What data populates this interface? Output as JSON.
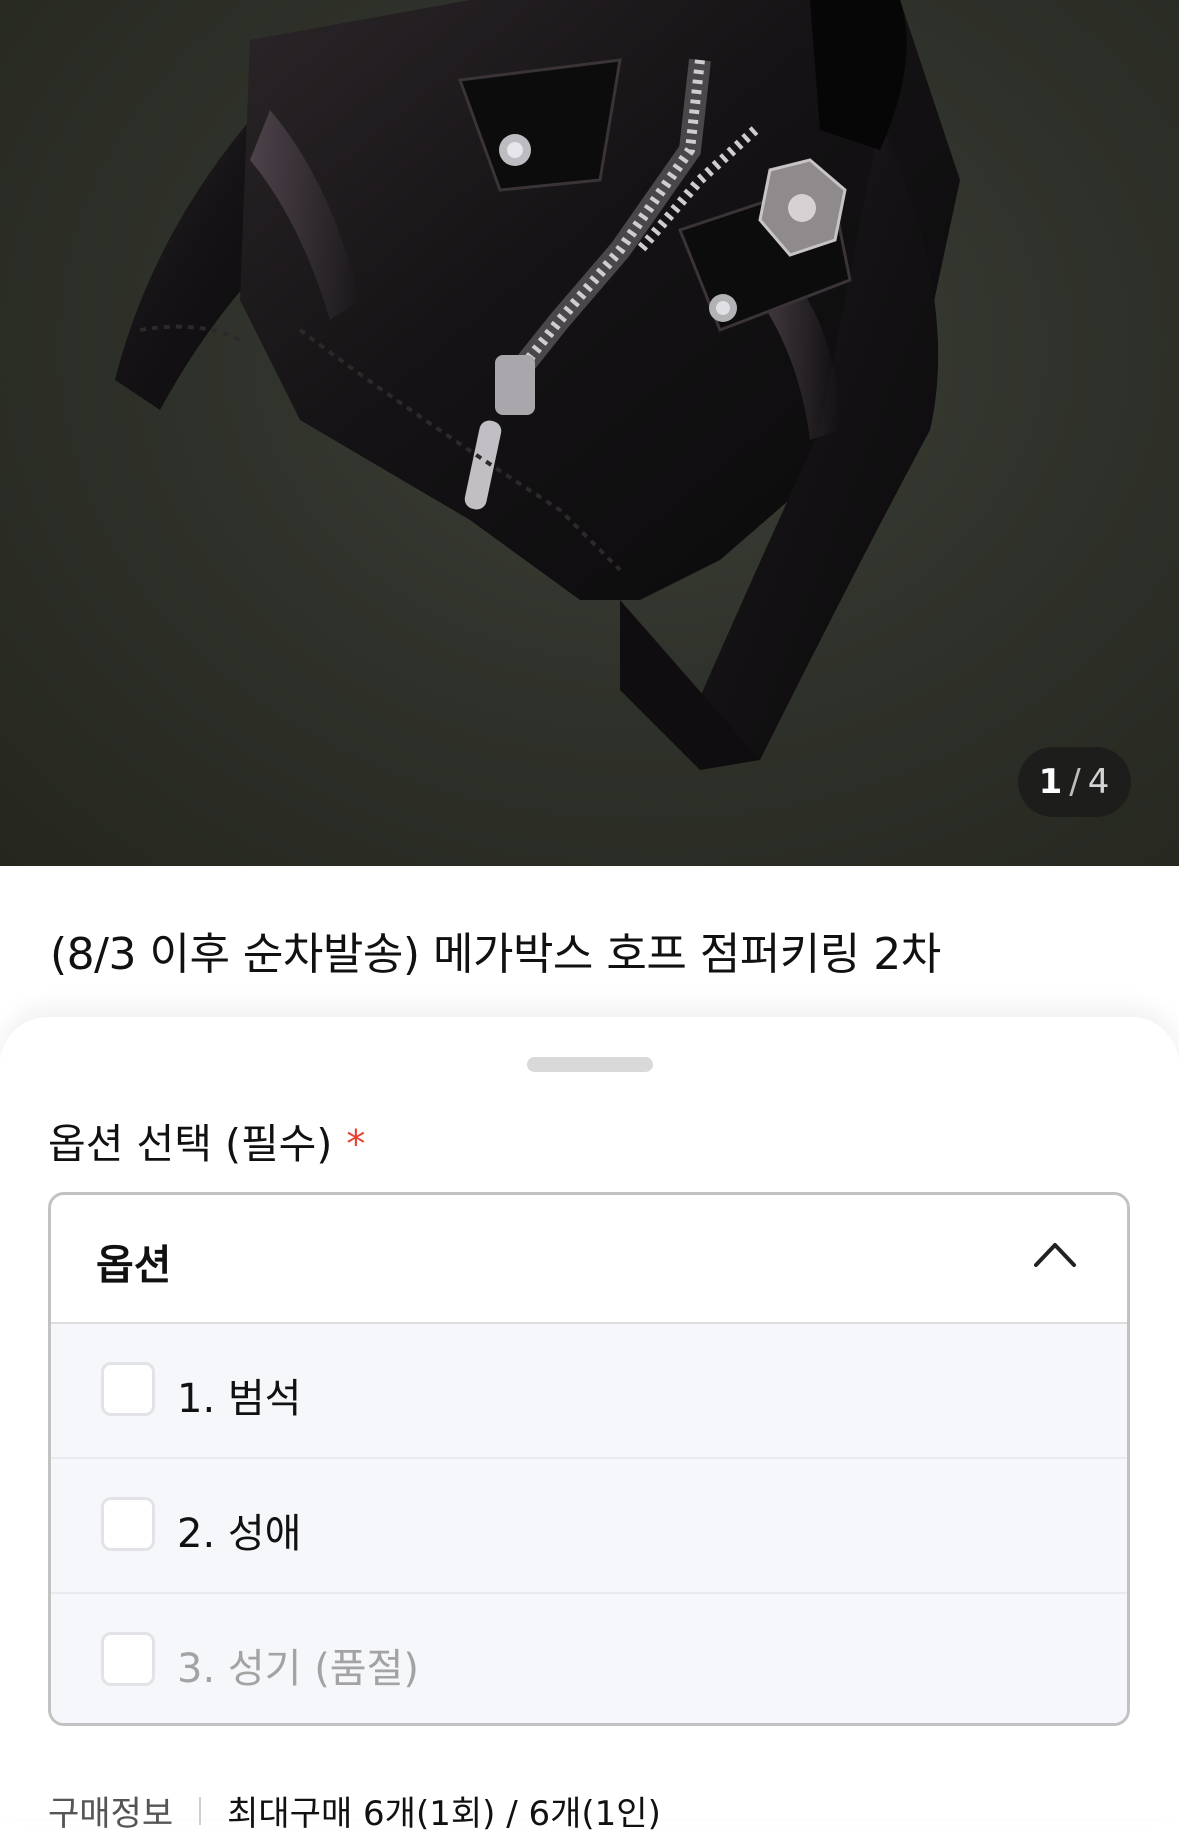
{
  "gallery": {
    "image_subject": "black leather jacket keyring",
    "current_index": "1",
    "separator": "/",
    "total": "4"
  },
  "product": {
    "title": "(8/3 이후 순차발송) 메가박스 호프 점퍼키링 2차"
  },
  "option_sheet": {
    "section_label": "옵션 선택 (필수)",
    "required_marker": "*",
    "select_label": "옵션",
    "expanded": true,
    "options": [
      {
        "label": "1. 범석",
        "checked": false,
        "disabled": false
      },
      {
        "label": "2. 성애",
        "checked": false,
        "disabled": false
      },
      {
        "label": "3. 성기 (품절)",
        "checked": false,
        "disabled": true
      }
    ]
  },
  "purchase_info": {
    "label": "구매정보",
    "limit_text": "최대구매 6개(1회) / 6개(1인)"
  },
  "colors": {
    "required_star": "#e8412f",
    "option_list_bg": "#f6f7fb",
    "disabled_text": "#a3a3a3"
  }
}
